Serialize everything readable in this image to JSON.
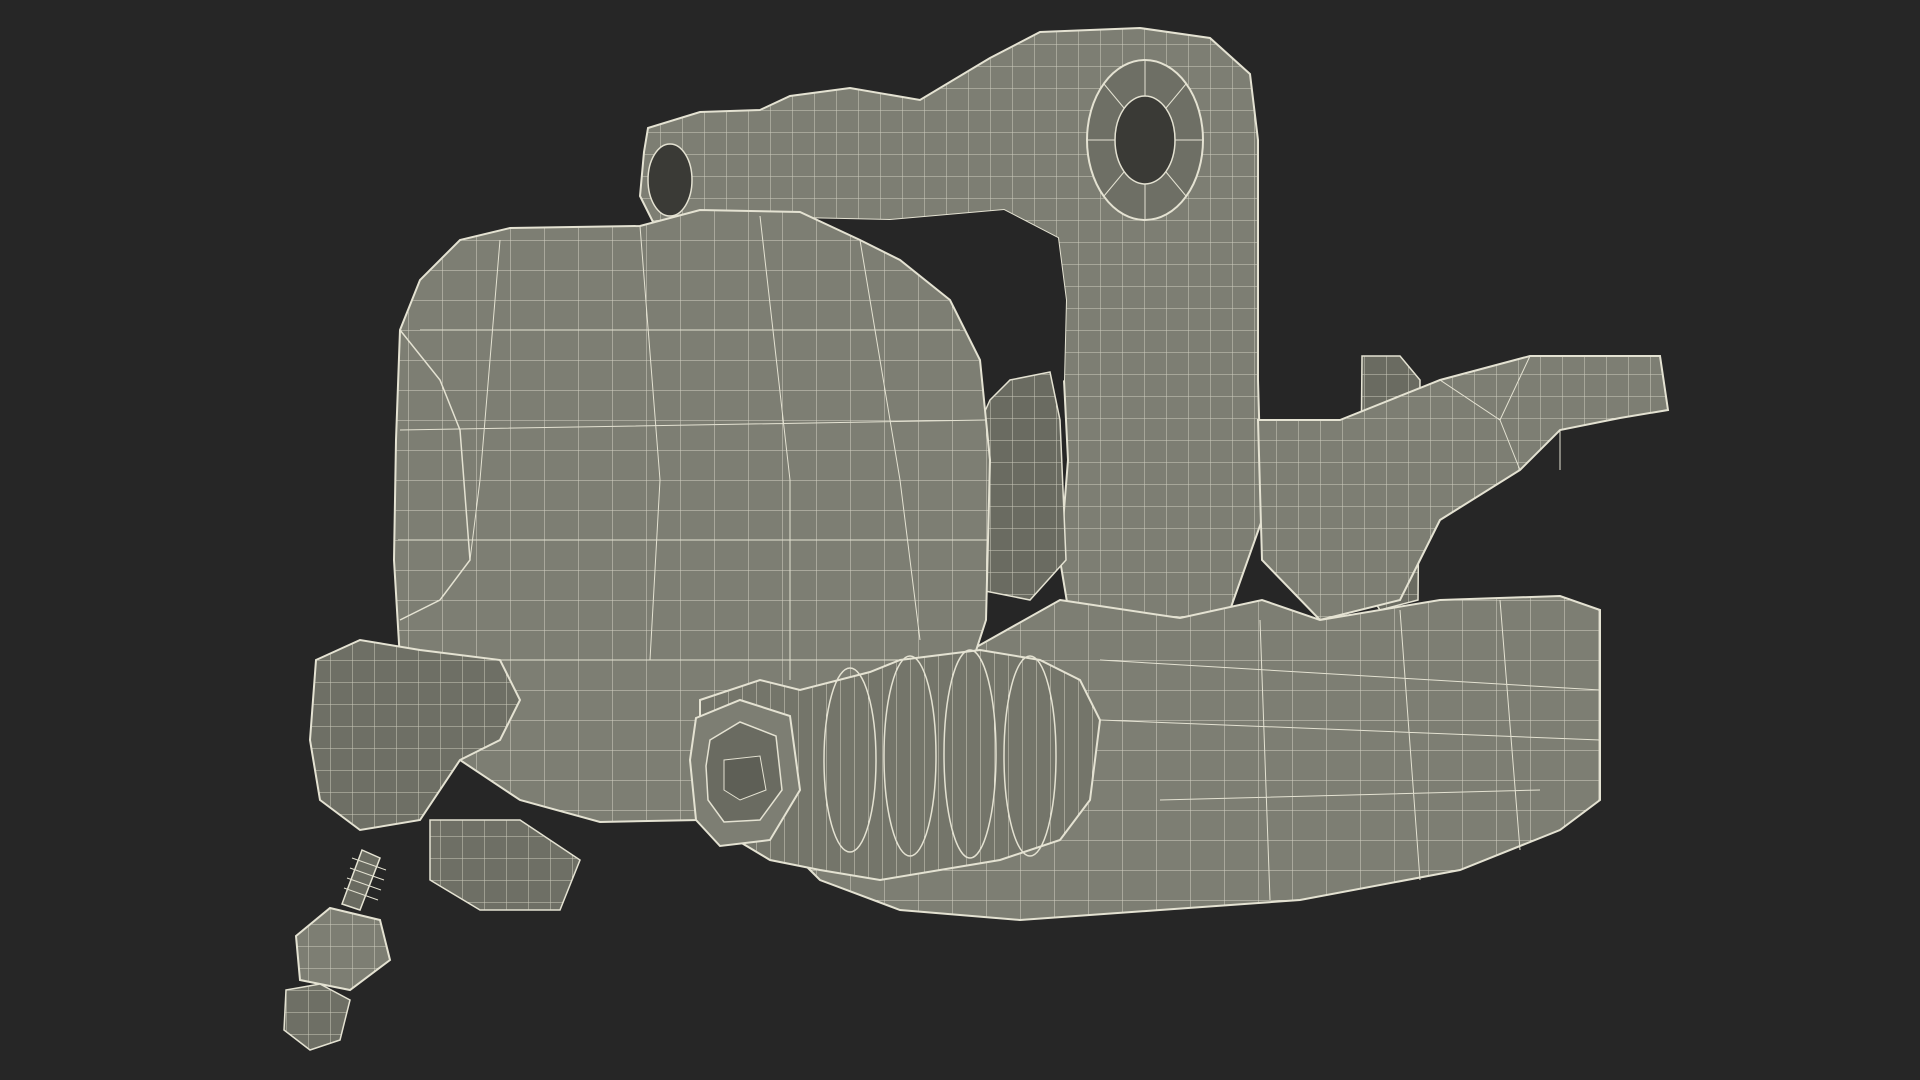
{
  "scene": {
    "background_color": "#262626",
    "model_fill_color": "#7d7e73",
    "model_shadow_color": "#6a6b61",
    "model_highlight_color": "#8d8e83",
    "wire_color": "#e4e2d2",
    "subject": "brake-caliper-wireframe-model"
  }
}
